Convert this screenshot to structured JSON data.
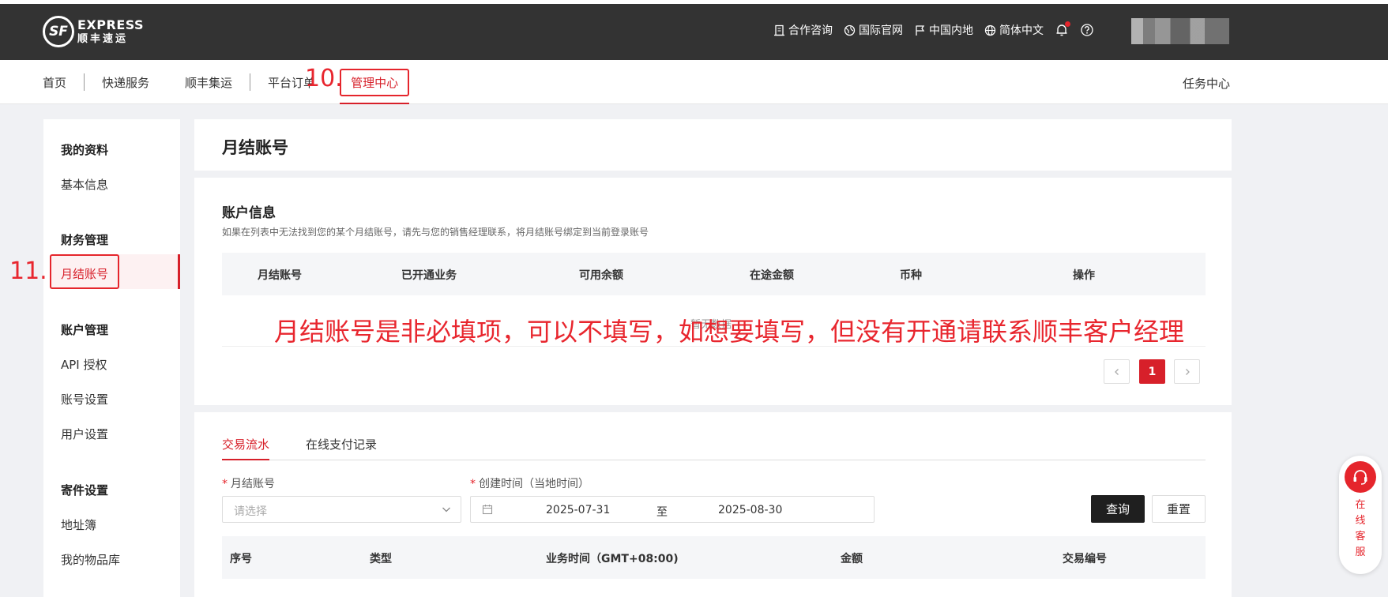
{
  "logo": {
    "mark": "SF",
    "line1": "EXPRESS",
    "line2": "顺丰速运"
  },
  "top_links": [
    {
      "label": "合作咨询",
      "icon": "building-icon"
    },
    {
      "label": "国际官网",
      "icon": "earth-icon"
    },
    {
      "label": "中国内地",
      "icon": "flag-icon"
    },
    {
      "label": "简体中文",
      "icon": "globe-icon"
    }
  ],
  "nav": {
    "items": [
      "首页",
      "快递服务",
      "顺丰集运",
      "平台订单",
      "管理中心"
    ],
    "task_center": "任务中心"
  },
  "annotations": {
    "step10": "10.",
    "step11": "11."
  },
  "sidebar": {
    "group_profile": "我的资料",
    "basic_info": "基本信息",
    "group_finance": "财务管理",
    "monthly_account": "月结账号",
    "group_account": "账户管理",
    "api_auth": "API 授权",
    "account_settings": "账号设置",
    "user_settings": "用户设置",
    "group_shipping": "寄件设置",
    "address_book": "地址簿",
    "item_library": "我的物品库"
  },
  "page": {
    "title": "月结账号",
    "account_info": {
      "title": "账户信息",
      "desc": "如果在列表中无法找到您的某个月结账号，请先与您的销售经理联系，将月结账号绑定到当前登录账号",
      "columns": [
        "月结账号",
        "已开通业务",
        "可用余额",
        "在途金额",
        "币种",
        "操作"
      ],
      "empty_text": "暂无数据",
      "current_page": "1"
    },
    "overlay_note": "月结账号是非必填项，可以不填写，如想要填写，但没有开通请联系顺丰客户经理",
    "transactions": {
      "tabs": [
        "交易流水",
        "在线支付记录"
      ],
      "account_label": "月结账号",
      "account_placeholder": "请选择",
      "time_label": "创建时间（当地时间）",
      "date_from": "2025-07-31",
      "date_sep": "至",
      "date_to": "2025-08-30",
      "query": "查询",
      "reset": "重置",
      "columns": [
        "序号",
        "类型",
        "业务时间（GMT+08:00)",
        "金额",
        "交易编号"
      ]
    }
  },
  "customer_service": {
    "chars": [
      "在",
      "线",
      "客",
      "服"
    ]
  },
  "colors": {
    "accent": "#d7202a",
    "topbar": "#333333",
    "annotation": "#e8262e"
  }
}
